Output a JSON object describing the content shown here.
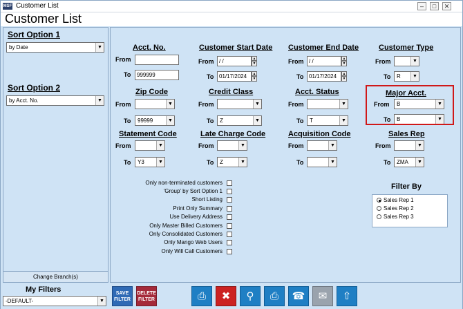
{
  "window": {
    "title": "Customer List",
    "header": "Customer List",
    "icon_label": "MSF"
  },
  "left": {
    "sort1": {
      "label": "Sort Option 1",
      "value": "by Date"
    },
    "sort2": {
      "label": "Sort Option 2",
      "value": "by Acct. No."
    },
    "change_branch": "Change Branch(s)"
  },
  "labels": {
    "from": "From",
    "to": "To"
  },
  "acct_no": {
    "title": "Acct. No.",
    "from": "",
    "to": "999999"
  },
  "start_date": {
    "title": "Customer Start Date",
    "from": " / /",
    "to": "01/17/2024"
  },
  "end_date": {
    "title": "Customer End Date",
    "from": " / /",
    "to": "01/17/2024"
  },
  "customer_type": {
    "title": "Customer Type",
    "from": "",
    "to": "R"
  },
  "zip": {
    "title": "Zip Code",
    "from": "",
    "to": "99999"
  },
  "credit_class": {
    "title": "Credit Class",
    "from": "",
    "to": "Z"
  },
  "acct_status": {
    "title": "Acct. Status",
    "from": "",
    "to": "T"
  },
  "major_acct": {
    "title": "Major Acct.",
    "from": "B",
    "to": "B"
  },
  "statement_code": {
    "title": "Statement Code",
    "from": "",
    "to": "Y3"
  },
  "late_charge": {
    "title": "Late Charge Code",
    "from": "",
    "to": "Z"
  },
  "acquisition": {
    "title": "Acquisition Code",
    "from": "",
    "to": ""
  },
  "sales_rep": {
    "title": "Sales Rep",
    "from": "",
    "to": "ZMA"
  },
  "options": [
    "Only non-terminated customers",
    "'Group' by Sort Option 1",
    "Short Listing",
    "Print Only Summary",
    "Use Delivery Address",
    "Only Master Billed Customers",
    "Only Consolidated Customers",
    "Only Mango Web Users",
    "Only Will Call Customers"
  ],
  "filter_by": {
    "title": "Filter By",
    "options": [
      "Sales Rep 1",
      "Sales Rep 2",
      "Sales Rep 3"
    ],
    "selected": "Sales Rep 1"
  },
  "bottom": {
    "my_filters": "My Filters",
    "filter_value": "-DEFAULT-",
    "save_filter": [
      "SAVE",
      "FILTER"
    ],
    "delete_filter": [
      "DELETE",
      "FILTER"
    ]
  },
  "colors": {
    "accent": "#1f7fc4",
    "save": "#2f6ab5",
    "delete": "#a52a3a",
    "highlight": "#d01818"
  }
}
